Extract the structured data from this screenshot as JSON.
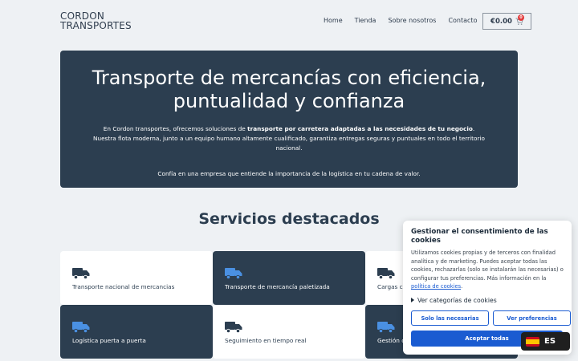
{
  "header": {
    "logo_line1": "CORDON",
    "logo_line2": "TRANSPORTES",
    "nav": [
      "Home",
      "Tienda",
      "Sobre nosotros",
      "Contacto"
    ],
    "cart_total": "€0.00",
    "cart_count": "0"
  },
  "hero": {
    "title": "Transporte de mercancías con eficiencia, puntualidad y confianza",
    "p1_before": "En Cordon transportes, ofrecemos soluciones de ",
    "p1_bold": "transporte por carretera adaptadas a las necesidades de tu negocio",
    "p1_after": ". Nuestra flota moderna, junto a un equipo humano altamente cualificado, garantiza entregas seguras y puntuales en todo el territorio nacional.",
    "p2": "Confía en una empresa que entiende la importancia de la logística en tu cadena de valor."
  },
  "services": {
    "title": "Servicios destacados",
    "items": [
      "Transporte nacional de mercancias",
      "Transporte de mercancía paletizada",
      "Cargas c",
      "Logística puerta a puerta",
      "Seguimiento en tiempo real",
      "Gestión c"
    ]
  },
  "cookie": {
    "title": "Gestionar el consentimiento de las cookies",
    "text": "Utilizamos cookies propias y de terceros con finalidad analítica y de marketing. Puedes aceptar todas las cookies, rechazarlas (solo se instalarán las necesarias) o configurar tus preferencias. Más información en la ",
    "link": "política de cookies",
    "text_end": ".",
    "categories": "Ver categorías de cookies",
    "btn_necessary": "Solo las necesarias",
    "btn_prefs": "Ver preferencias",
    "btn_accept": "Aceptar todas"
  },
  "language": {
    "code": "ES"
  },
  "colors": {
    "navy": "#2c3e50",
    "accent_blue": "#1a5bd1",
    "truck_blue": "#4a90e2"
  }
}
